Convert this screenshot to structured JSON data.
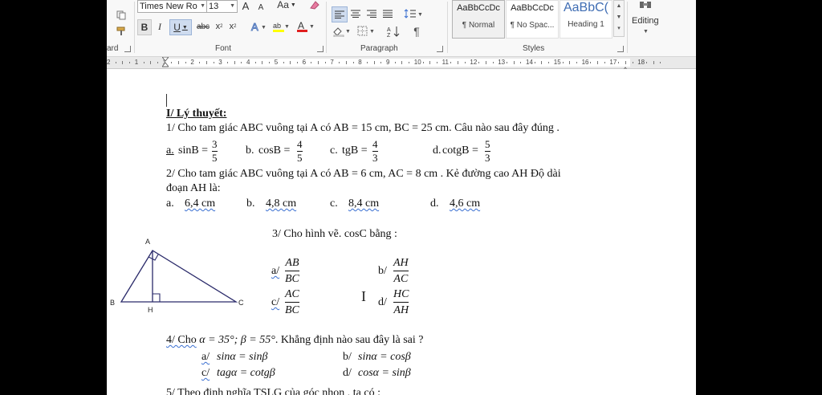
{
  "ribbon": {
    "font_name": "Times New Ro",
    "font_size": "13",
    "grow_font": "A",
    "shrink_font": "A",
    "change_case": "Aa",
    "bold": "B",
    "italic": "I",
    "underline": "U",
    "strike": "abc",
    "subscript": "x",
    "superscript": "x",
    "font_color_letter": "A",
    "groups": {
      "clipboard": "ard",
      "font": "Font",
      "paragraph": "Paragraph",
      "styles": "Styles"
    },
    "styles": [
      {
        "sample": "AaBbCcDc",
        "name": "¶ Normal"
      },
      {
        "sample": "AaBbCcDc",
        "name": "¶ No Spac..."
      },
      {
        "sample": "AaBbC(",
        "name": "Heading 1"
      }
    ],
    "editing": "Editing"
  },
  "ruler": {
    "numbers": [
      "2",
      "1",
      "1",
      "2",
      "3",
      "4",
      "5",
      "6",
      "7",
      "8",
      "9",
      "10",
      "11",
      "12",
      "13",
      "14",
      "15",
      "16",
      "17",
      "18"
    ]
  },
  "doc": {
    "heading": "I/ Lý thuyết:",
    "q1": {
      "stem": "1/ Cho tam giác ABC vuông tại A có AB = 15 cm, BC = 25 cm. Câu nào sau đây đúng .",
      "options": [
        {
          "label": "a.",
          "func": "sinB =",
          "num": "3",
          "den": "5"
        },
        {
          "label": "b.",
          "func": "cosB =",
          "num": "4",
          "den": "5"
        },
        {
          "label": "c.",
          "func": "tgB =",
          "num": "4",
          "den": "3"
        },
        {
          "label": "d.",
          "func": "cotgB =",
          "num": "5",
          "den": "3"
        }
      ]
    },
    "q2": {
      "line1": "2/ Cho tam giác ABC vuông tại A có AB = 6 cm, AC = 8 cm . Kẻ đường cao AH Độ dài",
      "line2": "đoạn AH là:",
      "options": [
        {
          "label": "a.",
          "value": "6,4 cm"
        },
        {
          "label": "b.",
          "value": "4,8 cm"
        },
        {
          "label": "c.",
          "value": "8,4 cm"
        },
        {
          "label": "d.",
          "value": "4,6 cm"
        }
      ]
    },
    "q3": {
      "stem": "3/ Cho hình vẽ. cosC  bằng :",
      "figure": {
        "A": "A",
        "B": "B",
        "C": "C",
        "H": "H"
      },
      "options": [
        {
          "label": "a/",
          "num": "AB",
          "den": "BC"
        },
        {
          "label": "b/",
          "num": "AH",
          "den": "AC"
        },
        {
          "label": "c/",
          "num": "AC",
          "den": "BC"
        },
        {
          "label": "d/",
          "num": "HC",
          "den": "AH"
        }
      ]
    },
    "q4": {
      "stem_prefix": "4/ Cho",
      "stem_math": "α = 35°; β = 55°",
      "stem_suffix": ". Khẳng định nào sau đây là sai ?",
      "options": [
        {
          "label": "a/",
          "expr": "sinα = sinβ"
        },
        {
          "label": "b/",
          "expr": "sinα = cosβ"
        },
        {
          "label": "c/",
          "expr": "tagα = cotgβ"
        },
        {
          "label": "d/",
          "expr": "cosα = sinβ"
        }
      ]
    },
    "q5_partial": "5/ Theo định nghĩa TSLG của góc nhọn , ta có :"
  }
}
